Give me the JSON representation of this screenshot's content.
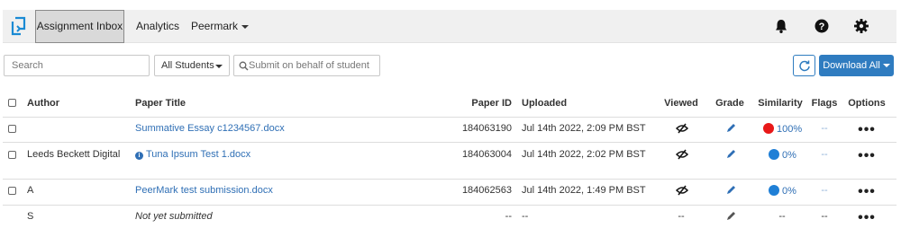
{
  "nav": {
    "tabs": [
      {
        "label": "Assignment Inbox",
        "active": true
      },
      {
        "label": "Analytics",
        "active": false
      },
      {
        "label": "Peermark",
        "active": false
      }
    ],
    "icons": [
      "bell-icon",
      "help-icon",
      "gear-icon"
    ]
  },
  "toolbar": {
    "search_placeholder": "Search",
    "filter_value": "All Students",
    "submit_placeholder": "Submit on behalf of student",
    "download_label": "Download All"
  },
  "table": {
    "headers": {
      "author": "Author",
      "title": "Paper Title",
      "paper_id": "Paper ID",
      "uploaded": "Uploaded",
      "viewed": "Viewed",
      "grade": "Grade",
      "similarity": "Similarity",
      "flags": "Flags",
      "options": "Options"
    },
    "rows": [
      {
        "author": "",
        "title": "Summative Essay c1234567.docx",
        "paper_id": "184063190",
        "uploaded": "Jul 14th 2022, 2:09 PM BST",
        "similarity": "100%",
        "flags": "--",
        "info": false
      },
      {
        "author": "Leeds Beckett Digital",
        "title": "Tuna Ipsum Test 1.docx",
        "paper_id": "184063004",
        "uploaded": "Jul 14th 2022, 2:02 PM BST",
        "similarity": "0%",
        "flags": "--",
        "info": true
      },
      {
        "author": "A",
        "title": "PeerMark test submission.docx",
        "paper_id": "184062563",
        "uploaded": "Jul 14th 2022, 1:49 PM BST",
        "similarity": "0%",
        "flags": "--",
        "info": false
      },
      {
        "author": "S",
        "title": "Not yet submitted",
        "paper_id": "--",
        "uploaded": "--",
        "viewed": "--",
        "similarity": "--",
        "flags": "--"
      }
    ]
  },
  "colors": {
    "accent": "#2f7cc0",
    "similarity_high": "#e81818",
    "similarity_low": "#1f7fd6"
  }
}
